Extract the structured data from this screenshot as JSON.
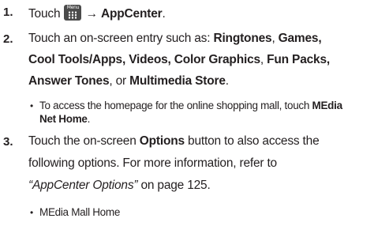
{
  "steps": [
    {
      "number": "1.",
      "touch": "Touch",
      "menu_icon_label": "Menu",
      "arrow": "→",
      "target": "AppCenter",
      "period": "."
    },
    {
      "number": "2.",
      "l1_a": "Touch an on-screen entry such as: ",
      "l1_b": "Ringtones",
      "l1_c": ", ",
      "l1_d": "Games,",
      "l2_a": "Cool Tools/Apps, Videos, Color Graphics",
      "l2_b": ", ",
      "l2_c": "Fun Packs,",
      "l3_a": "Answer Tones",
      "l3_b": ", or ",
      "l3_c": "Multimedia Store",
      "l3_d": ".",
      "bullet_l1_a": "To access the homepage for the online shopping mall, touch ",
      "bullet_l1_b": "MEdia",
      "bullet_l2_a": "Net Home",
      "bullet_l2_b": "."
    },
    {
      "number": "3.",
      "l1_a": "Touch the on-screen ",
      "l1_b": "Options",
      "l1_c": " button to also access the",
      "l2": "following options. For more information, refer to",
      "l3_a": "“AppCenter Options”",
      "l3_b": "  on page 125.",
      "bullet_l1": "MEdia Mall Home"
    }
  ]
}
